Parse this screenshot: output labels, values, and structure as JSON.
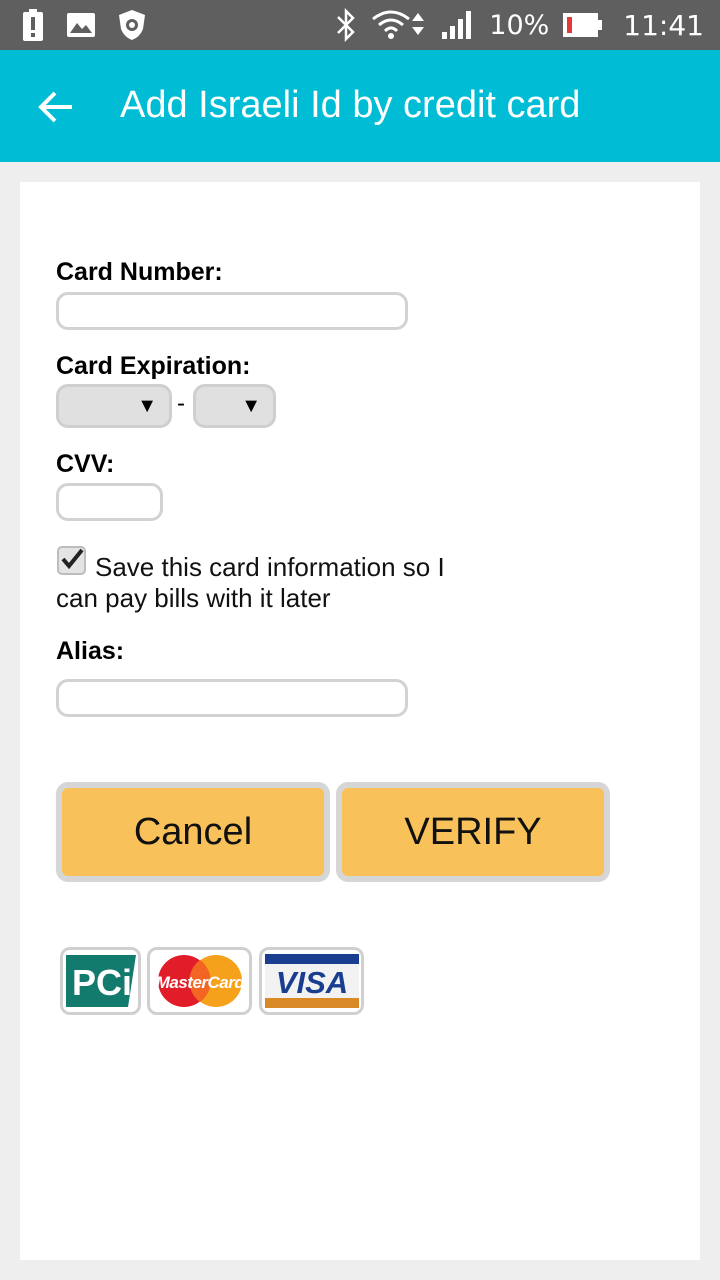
{
  "status_bar": {
    "left_icons": [
      "battery-alert-icon",
      "image-icon",
      "shield-icon"
    ],
    "right_icons": [
      "bluetooth-icon",
      "wifi-icon",
      "signal-icon",
      "battery-icon"
    ],
    "battery_percent": "10%",
    "time": "11:41"
  },
  "app_bar": {
    "title": "Add Israeli Id by credit card",
    "color": "#00bcd4"
  },
  "form": {
    "card_number_label": "Card Number:",
    "card_number_value": "",
    "card_expiration_label": "Card Expiration:",
    "expiration_month": "",
    "expiration_year": "",
    "expiration_separator": "-",
    "cvv_label": "CVV:",
    "cvv_value": "",
    "save_card_checked": true,
    "save_card_text": "Save this card information so I can pay bills with it later",
    "alias_label": "Alias:",
    "alias_value": ""
  },
  "buttons": {
    "cancel_label": "Cancel",
    "verify_label": "VERIFY",
    "button_color": "#f8c15a"
  },
  "badges": {
    "pci_text": "PCi",
    "mastercard_text": "MasterCard",
    "visa_text": "VISA"
  }
}
